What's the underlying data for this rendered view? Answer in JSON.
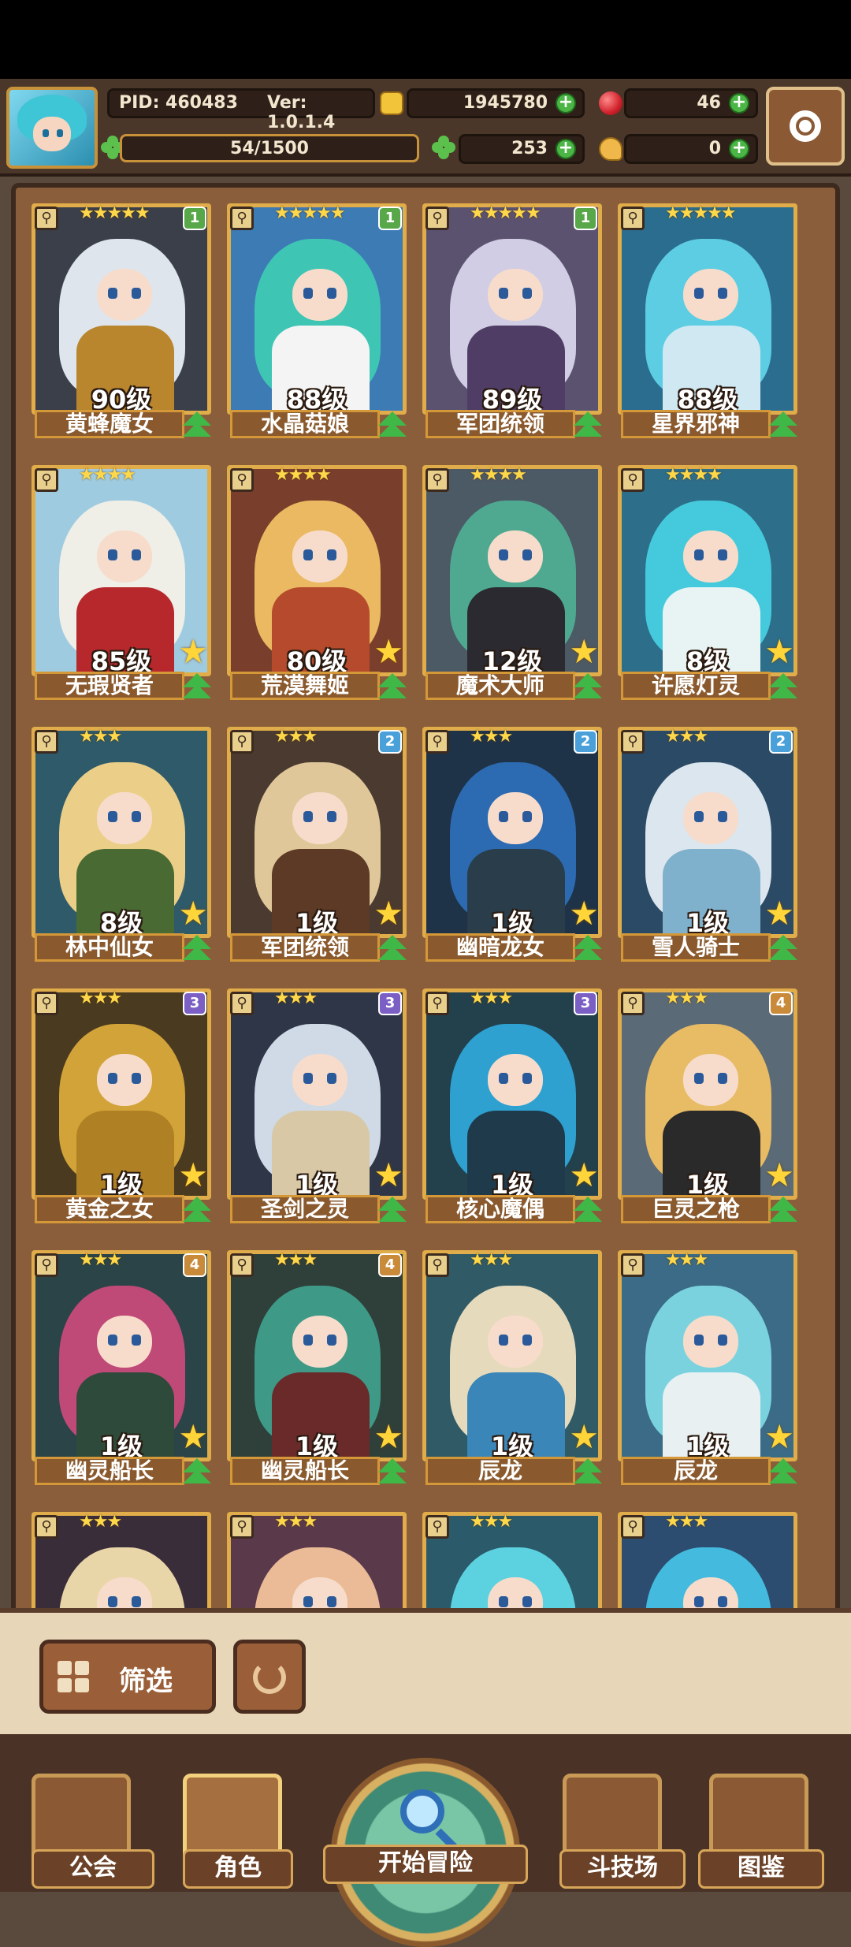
{
  "player": {
    "pid": "PID: 460483",
    "version": "Ver: 1.0.1.4",
    "gold": "1945780",
    "gems": "46",
    "clover": "253",
    "other_currency": "0",
    "stamina": "54/1500"
  },
  "colors": {
    "rank1": "#58a84a",
    "rank2": "#4aa0d8",
    "rank3": "#7b5fc4",
    "rank4": "#c98a3a"
  },
  "characters": [
    {
      "name": "黄蜂魔女",
      "level": "90级",
      "stars": "★★★★★",
      "rank": "1",
      "hair": "#e8eef5",
      "body": "#b9862e",
      "bg": "#3a3f4a"
    },
    {
      "name": "水晶菇娘",
      "level": "88级",
      "stars": "★★★★★",
      "rank": "1",
      "hair": "#3ec9b4",
      "body": "#f4f4f4",
      "bg": "#3d7bb5"
    },
    {
      "name": "军团统领",
      "level": "89级",
      "stars": "★★★★★",
      "rank": "1",
      "hair": "#d8d4ea",
      "body": "#4f3d66",
      "bg": "#5b5270"
    },
    {
      "name": "星界邪神",
      "level": "88级",
      "stars": "★★★★★",
      "rank": "",
      "hair": "#5fd3e8",
      "body": "#cfe8f2",
      "bg": "#2b6d8e"
    },
    {
      "name": "无瑕贤者",
      "level": "85级",
      "stars": "★★★★",
      "rank": "",
      "hair": "#f3efe7",
      "body": "#b7282c",
      "bg": "#9fcbe0"
    },
    {
      "name": "荒漠舞姬",
      "level": "80级",
      "stars": "★★★★",
      "rank": "",
      "hair": "#f1c064",
      "body": "#b54a2c",
      "bg": "#7a3f2c"
    },
    {
      "name": "魔术大师",
      "level": "12级",
      "stars": "★★★★",
      "rank": "",
      "hair": "#4fae94",
      "body": "#2a2a30",
      "bg": "#4c5a66"
    },
    {
      "name": "许愿灯灵",
      "level": "8级",
      "stars": "★★★★",
      "rank": "",
      "hair": "#46cfe0",
      "body": "#e8f4f4",
      "bg": "#2d6e8a"
    },
    {
      "name": "林中仙女",
      "level": "8级",
      "stars": "★★★",
      "rank": "",
      "hair": "#f5d68a",
      "body": "#4a6a34",
      "bg": "#2e5a6a"
    },
    {
      "name": "军团统领",
      "level": "1级",
      "stars": "★★★",
      "rank": "2",
      "hair": "#e7cfa0",
      "body": "#5c3a26",
      "bg": "#4a3a30"
    },
    {
      "name": "幽暗龙女",
      "level": "1级",
      "stars": "★★★",
      "rank": "2",
      "hair": "#2d6fb8",
      "body": "#2a3d4a",
      "bg": "#1f3348"
    },
    {
      "name": "雪人骑士",
      "level": "1级",
      "stars": "★★★",
      "rank": "2",
      "hair": "#e6eef5",
      "body": "#7fb0cc",
      "bg": "#2b4a66"
    },
    {
      "name": "黄金之女",
      "level": "1级",
      "stars": "★★★",
      "rank": "3",
      "hair": "#d9a93a",
      "body": "#b08024",
      "bg": "#4a3a20"
    },
    {
      "name": "圣剑之灵",
      "level": "1级",
      "stars": "★★★",
      "rank": "3",
      "hair": "#d8e4ef",
      "body": "#d8c8a6",
      "bg": "#2e3648"
    },
    {
      "name": "核心魔偶",
      "level": "1级",
      "stars": "★★★",
      "rank": "3",
      "hair": "#2fa6d8",
      "body": "#1f3a4a",
      "bg": "#23404d"
    },
    {
      "name": "巨灵之枪",
      "level": "1级",
      "stars": "★★★",
      "rank": "4",
      "hair": "#f0c064",
      "body": "#2a2a2a",
      "bg": "#5a6a76"
    },
    {
      "name": "幽灵船长",
      "level": "1级",
      "stars": "★★★",
      "rank": "4",
      "hair": "#c74a7a",
      "body": "#2e4a3a",
      "bg": "#2a4448"
    },
    {
      "name": "幽灵船长",
      "level": "1级",
      "stars": "★★★",
      "rank": "4",
      "hair": "#3f9e8a",
      "body": "#6a2a2a",
      "bg": "#2f3f3a"
    },
    {
      "name": "辰龙",
      "level": "1级",
      "stars": "★★★",
      "rank": "",
      "hair": "#f0e1c2",
      "body": "#3a86b8",
      "bg": "#2f5a66"
    },
    {
      "name": "辰龙",
      "level": "1级",
      "stars": "★★★",
      "rank": "",
      "hair": "#7ed8e4",
      "body": "#e8f0f2",
      "bg": "#3b6b86"
    },
    {
      "name": "",
      "level": "",
      "stars": "★★★",
      "rank": "",
      "hair": "#f2dfae",
      "body": "#f2dfae",
      "bg": "#3a2d3a"
    },
    {
      "name": "",
      "level": "",
      "stars": "★★★",
      "rank": "",
      "hair": "#f2c29a",
      "body": "#f2c29a",
      "bg": "#5a3a4a"
    },
    {
      "name": "",
      "level": "",
      "stars": "★★★",
      "rank": "",
      "hair": "#5fd8e6",
      "body": "#5fd8e6",
      "bg": "#2b5a6a"
    },
    {
      "name": "",
      "level": "",
      "stars": "★★★",
      "rank": "",
      "hair": "#46c0e4",
      "body": "#46c0e4",
      "bg": "#2c4c70"
    }
  ],
  "filter": {
    "label": "筛选"
  },
  "nav": {
    "guild": "公会",
    "character": "角色",
    "adventure": "开始冒险",
    "arena": "斗技场",
    "codex": "图鉴"
  }
}
